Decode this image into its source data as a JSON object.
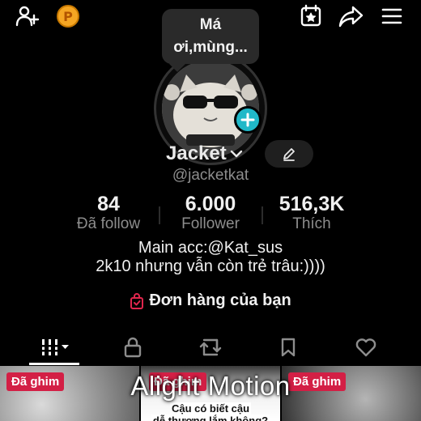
{
  "topbar": {
    "add_friend_icon": "person-add-icon",
    "coin_icon": "coin-icon",
    "coin_letter": "P",
    "calendar_icon": "calendar-star-icon",
    "share_icon": "share-arrow-icon",
    "menu_icon": "hamburger-menu-icon"
  },
  "note": {
    "line1": "Má",
    "line2": "ơi,mùng..."
  },
  "profile": {
    "name": "Jacket",
    "handle": "@jacketkat",
    "edit_icon": "pencil-icon"
  },
  "stats": [
    {
      "value": "84",
      "label": "Đã follow"
    },
    {
      "value": "6.000",
      "label": "Follower"
    },
    {
      "value": "516,3K",
      "label": "Thích"
    }
  ],
  "bio": {
    "line1": "Main acc:@Kat_sus",
    "line2": "2k10 nhưng vẫn còn trẻ trâu:))))"
  },
  "orders": {
    "label": "Đơn hàng của bạn",
    "icon": "shopping-bag-icon"
  },
  "tabs": [
    {
      "icon": "grid-icon"
    },
    {
      "icon": "lock-icon"
    },
    {
      "icon": "repost-icon"
    },
    {
      "icon": "bookmark-icon"
    },
    {
      "icon": "heart-icon"
    }
  ],
  "videos": [
    {
      "pin_label": "Đã ghim"
    },
    {
      "pin_label": "Đã ghim",
      "caption_line1": "Cậu có biết cậu",
      "caption_line2": "dễ thương lắm không?"
    },
    {
      "pin_label": "Đã ghim"
    }
  ],
  "watermark": "Alight Motion",
  "colors": {
    "accent_teal": "#20b8c8",
    "pin_red": "#d31f45",
    "coin_orange": "#f5a623",
    "background": "#000000"
  }
}
